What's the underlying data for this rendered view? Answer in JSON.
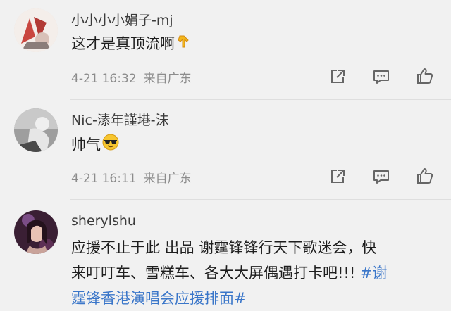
{
  "comments": [
    {
      "username": "小小小小娟子-mj",
      "text": "这才是真顶流啊",
      "emoji": "down-pointing-hand-emoji",
      "date": "4-21",
      "time": "16:32",
      "location": "来自广东"
    },
    {
      "username": "Nic-溸年謹塂-沬",
      "text": "帅气",
      "emoji": "sunglasses-emoji",
      "date": "4-21",
      "time": "16:11",
      "location": "来自广东"
    },
    {
      "username": "sherylshu",
      "text_line1": "应援不止于此  出品 谢霆锋锋行天下歌迷会，快",
      "text_line2_plain": "来叮叮车、雪糕车、各大大屏偶遇打卡吧!!! ",
      "hashtag_part1": "#谢",
      "hashtag_part2": "霆锋香港演唱会应援排面#"
    }
  ],
  "colors": {
    "background": "#f1f1f1",
    "hashtag": "#3a76c9",
    "meta": "#8c8c8c"
  },
  "icons": [
    "share-icon",
    "comment-icon",
    "like-icon"
  ]
}
